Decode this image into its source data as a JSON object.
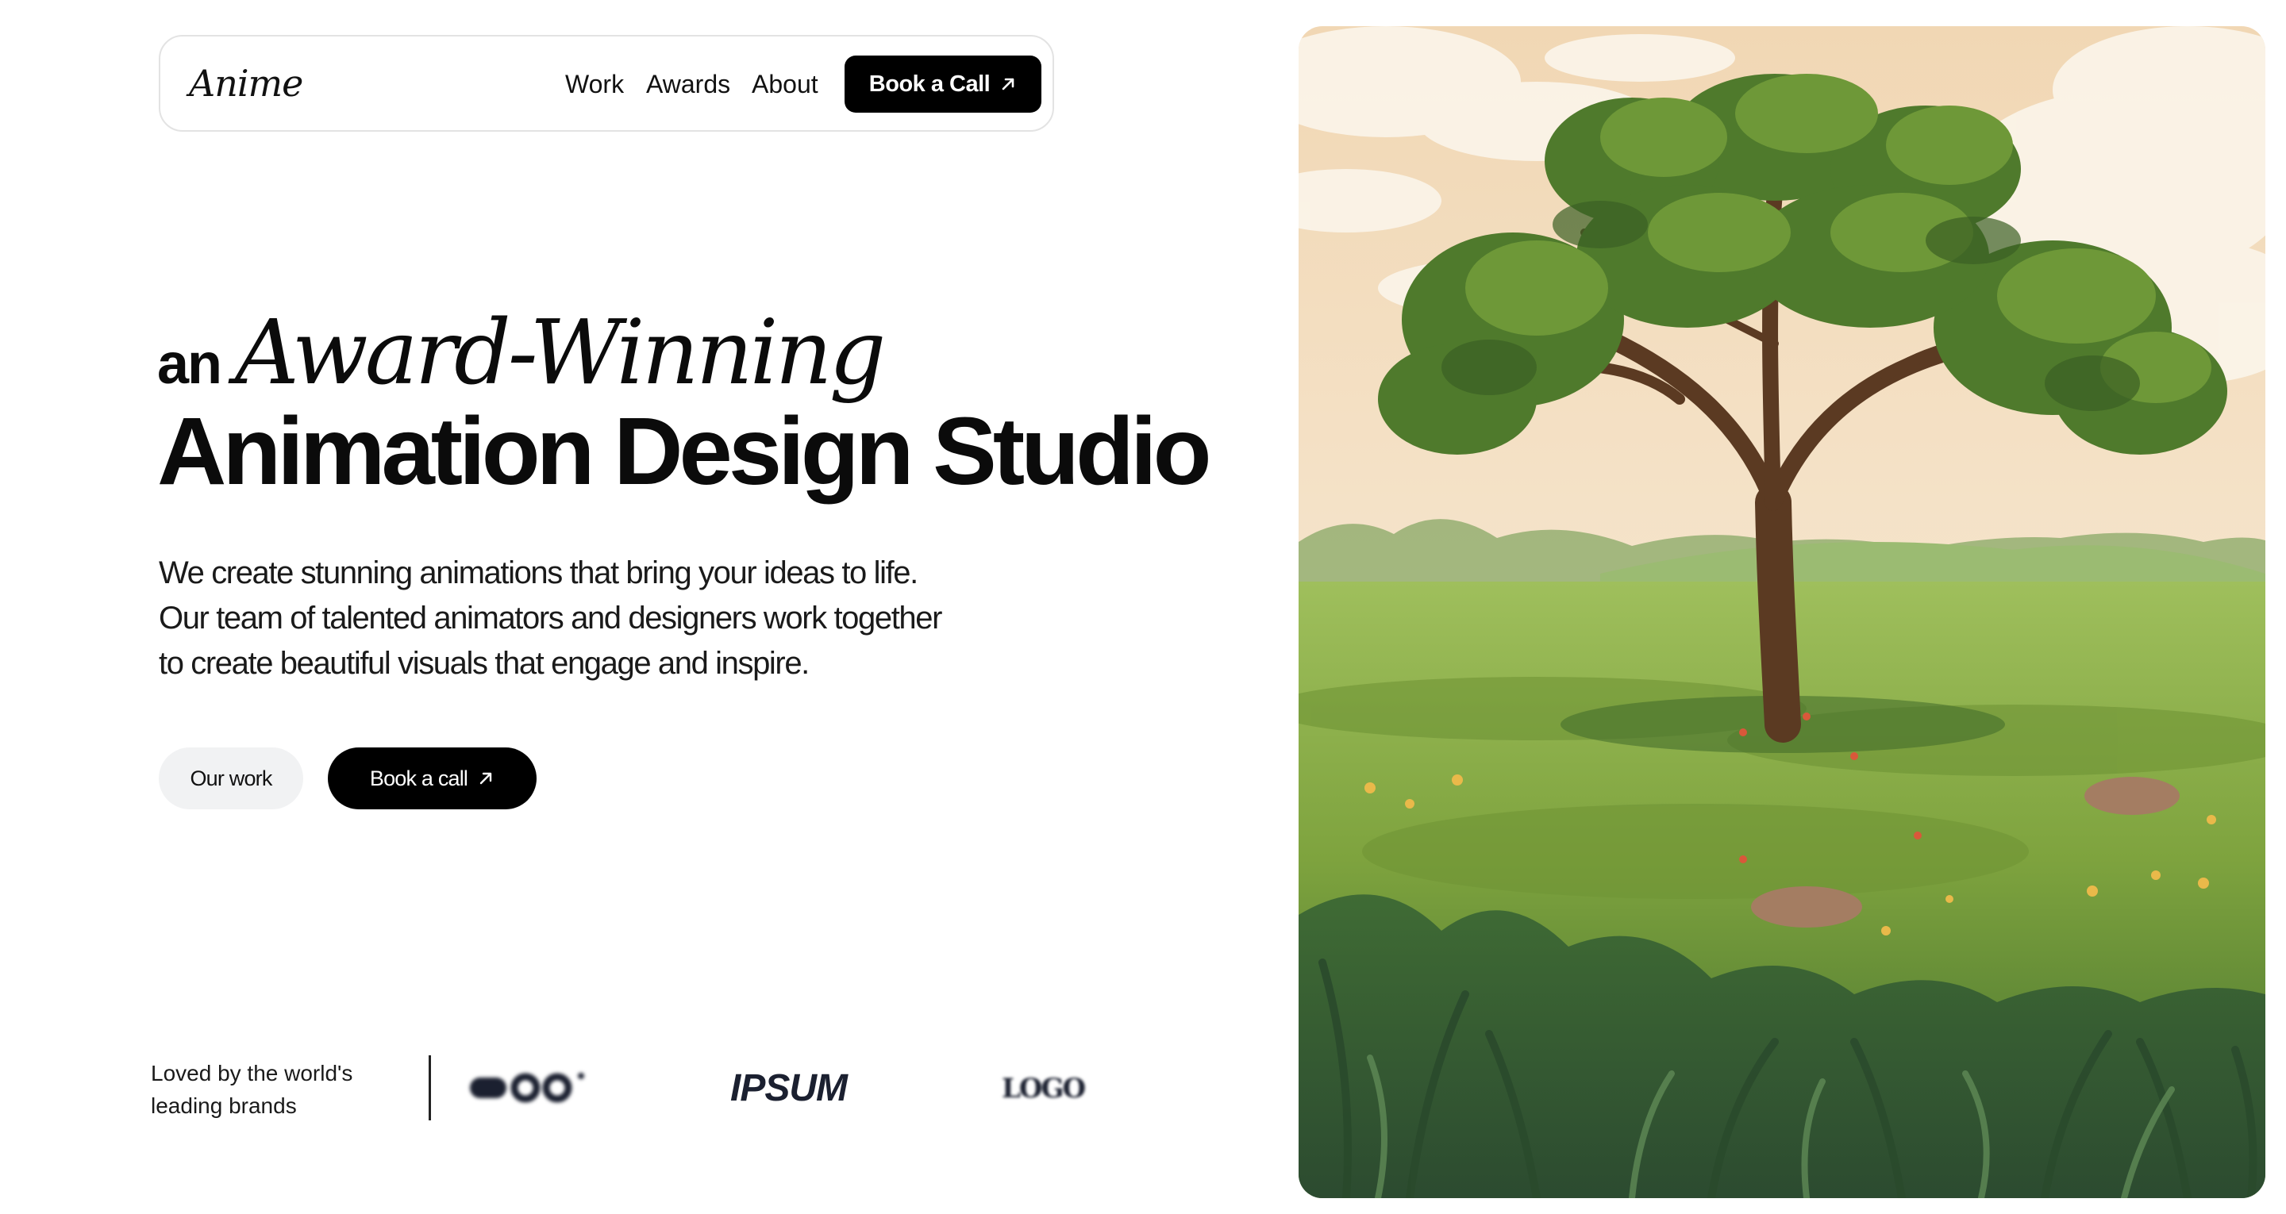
{
  "nav": {
    "logo": "Anime",
    "links": [
      "Work",
      "Awards",
      "About"
    ],
    "cta_label": "Book a Call"
  },
  "hero": {
    "prefix": "an",
    "script": "Award-Winning",
    "title": "Animation Design Studio",
    "description": "We create stunning animations that bring your ideas to life. Our team of talented animators and designers work together to create beautiful visuals that engage and inspire.",
    "primary_button": "Our work",
    "secondary_button": "Book a call"
  },
  "brands": {
    "label": "Loved by the world's leading brands",
    "logos": [
      "",
      "IPSUM",
      "LOGO"
    ]
  },
  "colors": {
    "black": "#000000",
    "ghost_button": "#f1f2f3",
    "nav_border": "#e3e3e3",
    "grass": "#7ea33e",
    "sky": "#f3dfc2"
  },
  "icons": {
    "cta_arrow": "arrow-up-right-icon"
  }
}
